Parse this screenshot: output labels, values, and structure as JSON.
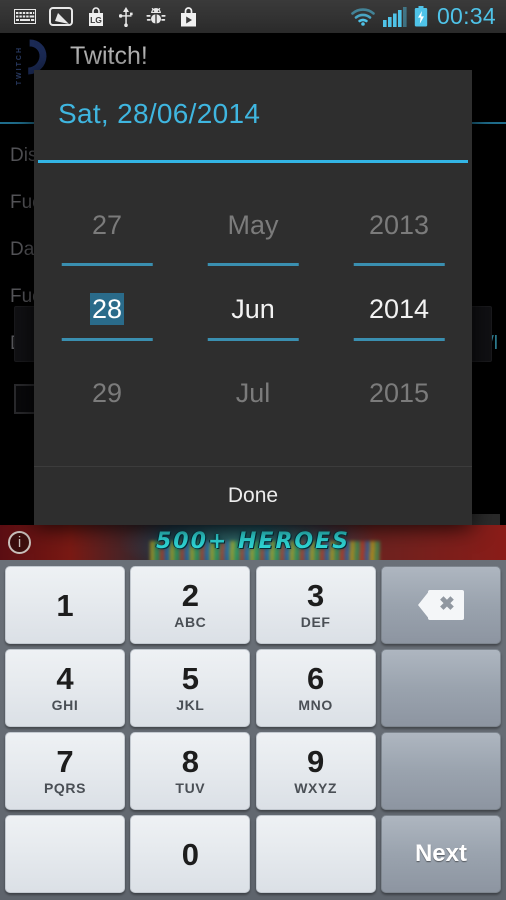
{
  "status_bar": {
    "time": "00:34",
    "left_icons": [
      {
        "name": "keyboard-icon",
        "glyph": "keyboard"
      },
      {
        "name": "screen-capture-icon",
        "glyph": "screen"
      },
      {
        "name": "lg-app-icon",
        "glyph": "LG"
      },
      {
        "name": "usb-icon",
        "glyph": "usb"
      },
      {
        "name": "android-debug-icon",
        "glyph": "bug"
      },
      {
        "name": "play-store-icon",
        "glyph": "play-bag"
      }
    ],
    "right_icons": [
      {
        "name": "wifi-icon",
        "glyph": "wifi"
      },
      {
        "name": "signal-icon",
        "glyph": "bars"
      },
      {
        "name": "battery-charging-icon",
        "glyph": "battery-bolt"
      }
    ],
    "accent_color": "#4fc3e8"
  },
  "app": {
    "title": "Twitch!",
    "logo_text": "TWITCH",
    "accent_color": "#1f6d8c",
    "fields": [
      {
        "label": "Dist"
      },
      {
        "label": "Fue"
      },
      {
        "label": "Date"
      },
      {
        "label": "Fue"
      },
      {
        "label": "Dist"
      }
    ],
    "unit_text": "km/l"
  },
  "ad_banner": {
    "headline": "500+ HEROES",
    "info_glyph": "i",
    "text_color": "#2fd8d8"
  },
  "date_dialog": {
    "title": "Sat, 28/06/2014",
    "title_color": "#3fb6e0",
    "divider_color": "#33b5e5",
    "done_label": "Done",
    "spinners": [
      {
        "name": "day",
        "previous": "27",
        "current": "28",
        "next": "29",
        "selected": true
      },
      {
        "name": "month",
        "previous": "May",
        "current": "Jun",
        "next": "Jul",
        "selected": false
      },
      {
        "name": "year",
        "previous": "2013",
        "current": "2014",
        "next": "2015",
        "selected": false
      }
    ],
    "selection_highlight_color": "#2a6b8a"
  },
  "keyboard": {
    "rows": [
      [
        {
          "num": "1",
          "sub": "",
          "style": "light",
          "type": "digit"
        },
        {
          "num": "2",
          "sub": "ABC",
          "style": "light",
          "type": "digit"
        },
        {
          "num": "3",
          "sub": "DEF",
          "style": "light",
          "type": "digit"
        },
        {
          "num": "",
          "sub": "",
          "style": "dark",
          "type": "backspace"
        }
      ],
      [
        {
          "num": "4",
          "sub": "GHI",
          "style": "light",
          "type": "digit"
        },
        {
          "num": "5",
          "sub": "JKL",
          "style": "light",
          "type": "digit"
        },
        {
          "num": "6",
          "sub": "MNO",
          "style": "light",
          "type": "digit"
        },
        {
          "num": "",
          "sub": "",
          "style": "dark",
          "type": "blank"
        }
      ],
      [
        {
          "num": "7",
          "sub": "PQRS",
          "style": "light",
          "type": "digit"
        },
        {
          "num": "8",
          "sub": "TUV",
          "style": "light",
          "type": "digit"
        },
        {
          "num": "9",
          "sub": "WXYZ",
          "style": "light",
          "type": "digit"
        },
        {
          "num": "",
          "sub": "",
          "style": "dark",
          "type": "blank"
        }
      ],
      [
        {
          "num": "",
          "sub": "",
          "style": "light",
          "type": "blank"
        },
        {
          "num": "0",
          "sub": "",
          "style": "light",
          "type": "digit"
        },
        {
          "num": "",
          "sub": "",
          "style": "light",
          "type": "blank"
        },
        {
          "num": "",
          "sub": "",
          "style": "dark",
          "type": "action",
          "label": "Next"
        }
      ]
    ]
  }
}
